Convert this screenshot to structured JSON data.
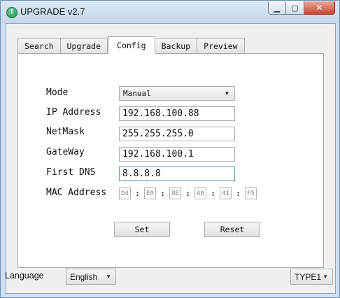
{
  "window": {
    "title": "UPGRADE v2.7",
    "app_icon": "up-arrow-icon",
    "minimize": "minimize-icon",
    "maximize": "maximize-icon",
    "close": "close-icon"
  },
  "tabs": [
    {
      "label": "Search"
    },
    {
      "label": "Upgrade"
    },
    {
      "label": "Config",
      "active": true
    },
    {
      "label": "Backup"
    },
    {
      "label": "Preview"
    }
  ],
  "config": {
    "mode_label": "Mode",
    "mode_value": "Manual",
    "ip_label": "IP Address",
    "ip_value": "192.168.100.88",
    "netmask_label": "NetMask",
    "netmask_value": "255.255.255.0",
    "gateway_label": "GateWay",
    "gateway_value": "192.168.100.1",
    "dns_label": "First DNS",
    "dns_value": "8.8.8.8",
    "mac_label": "MAC Address",
    "mac_segments": [
      "D4",
      "E0",
      "8E",
      "A0",
      "41",
      "F5"
    ],
    "mac_separator": ":",
    "set_label": "Set",
    "reset_label": "Reset"
  },
  "footer": {
    "language_label": "Language",
    "language_value": "English",
    "type_value": "TYPE1"
  },
  "colors": {
    "title_bar": "#c4d7eb",
    "close_button": "#c8472f",
    "focus_border": "#5a9bd5"
  }
}
